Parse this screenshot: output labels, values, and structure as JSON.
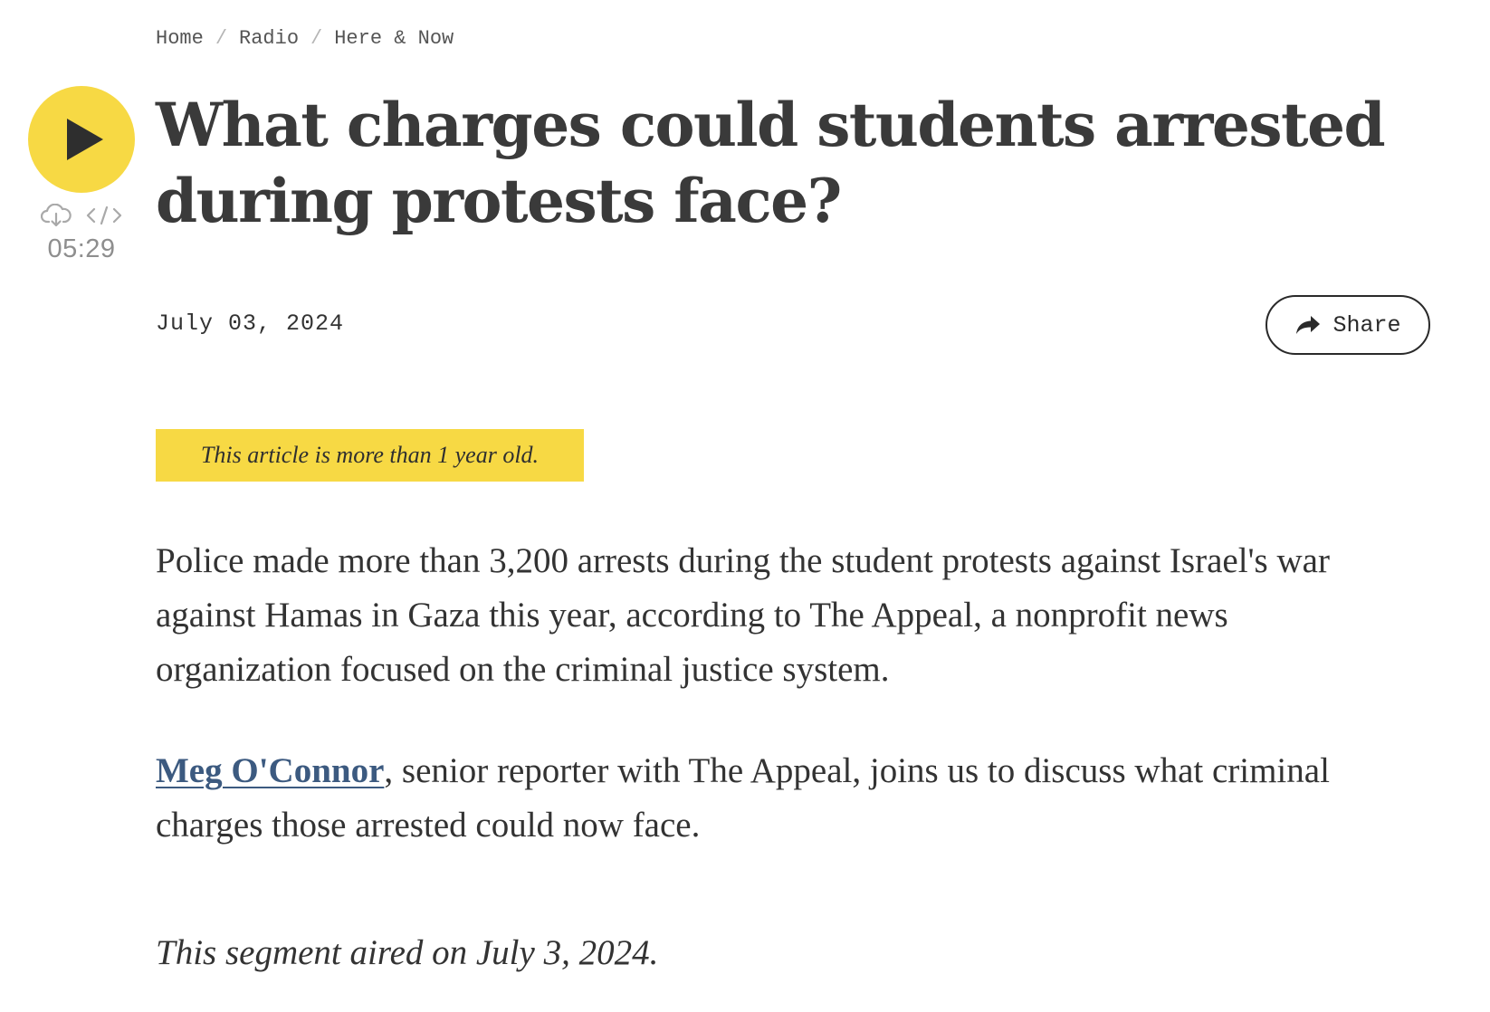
{
  "breadcrumb": {
    "items": [
      "Home",
      "Radio",
      "Here & Now"
    ],
    "separator": "/"
  },
  "player": {
    "play_icon": "play-icon",
    "download_icon": "download-icon",
    "embed_icon": "embed-code-icon",
    "duration": "05:29",
    "accent_color": "#f7d944"
  },
  "article": {
    "title": "What charges could students arrested during protests face?",
    "date": "July 03, 2024",
    "share_label": "Share",
    "share_icon": "share-arrow-icon",
    "age_notice": "This article is more than 1 year old.",
    "paragraph_1": "Police made more than 3,200 arrests during the student protests against Israel's war against Hamas in Gaza this year, according to The Appeal, a nonprofit news organization focused on the criminal justice system.",
    "paragraph_2_link": "Meg O'Connor",
    "paragraph_2_rest": ", senior reporter with The Appeal, joins us to discuss what criminal charges those arrested could now face.",
    "aired_note": "This segment aired on July 3, 2024.",
    "link_color": "#3c5a80"
  }
}
